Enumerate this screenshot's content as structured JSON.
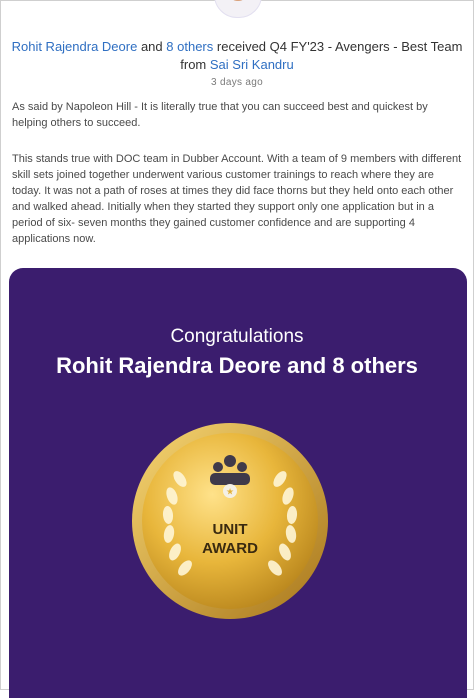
{
  "post": {
    "recipient_primary": "Rohit Rajendra Deore",
    "conjunction": "and",
    "recipient_others": "8 others",
    "received_text": "received Q4 FY'23 - Avengers - Best Team",
    "from_word": "from",
    "sender": "Sai Sri Kandru",
    "timestamp": "3 days ago",
    "paragraph_1": "As said by Napoleon Hill - It is literally true that you can succeed best and quickest by helping others to succeed.",
    "paragraph_2": "This stands true with DOC team in Dubber Account. With a team of 9 members with different skill sets joined together  underwent various customer trainings to reach where they are today. It was not a path of roses at times they did face thorns but they held  onto each other and walked ahead. Initially when they started they support only one application but in a period of six- seven months they gained customer confidence and are supporting 4 applications now."
  },
  "award_card": {
    "congratulations": "Congratulations",
    "recipients": "Rohit Rajendra Deore and 8 others",
    "medal_line_1": "UNIT",
    "medal_line_2": "AWARD",
    "background_color": "#3b1d6e",
    "medal_color": "#e2b23a",
    "icon": "team-icon"
  }
}
